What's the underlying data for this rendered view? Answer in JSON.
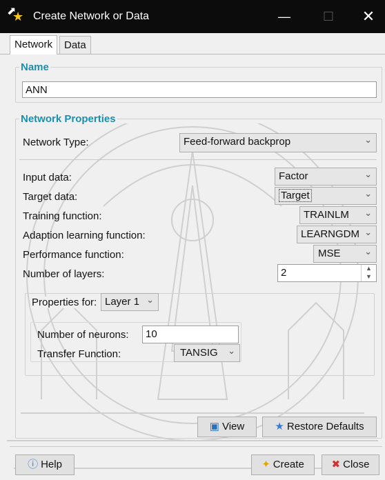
{
  "window": {
    "title": "Create Network or Data"
  },
  "tabs": [
    {
      "label": "Network"
    },
    {
      "label": "Data"
    }
  ],
  "name_group": {
    "title": "Name",
    "value": "ANN"
  },
  "props": {
    "title": "Network Properties",
    "network_type_label": "Network Type:",
    "network_type_value": "Feed-forward backprop",
    "input_data_label": "Input data:",
    "input_data_value": "Factor",
    "target_data_label": "Target data:",
    "target_data_value": "Target",
    "training_label": "Training function:",
    "training_value": "TRAINLM",
    "adaption_label": "Adaption learning function:",
    "adaption_value": "LEARNGDM",
    "performance_label": "Performance function:",
    "performance_value": "MSE",
    "layers_label": "Number of layers:",
    "layers_value": "2",
    "properties_for_label": "Properties for:",
    "properties_for_value": "Layer 1",
    "neurons_label": "Number of neurons:",
    "neurons_value": "10",
    "transfer_label": "Transfer Function:",
    "transfer_value": "TANSIG"
  },
  "buttons": {
    "view": "View",
    "restore": "Restore Defaults",
    "help": "Help",
    "create": "Create",
    "close": "Close"
  },
  "colors": {
    "section_title": "#1a8fae",
    "titlebar": "#0c0c0c",
    "background": "#f0f0f0"
  }
}
